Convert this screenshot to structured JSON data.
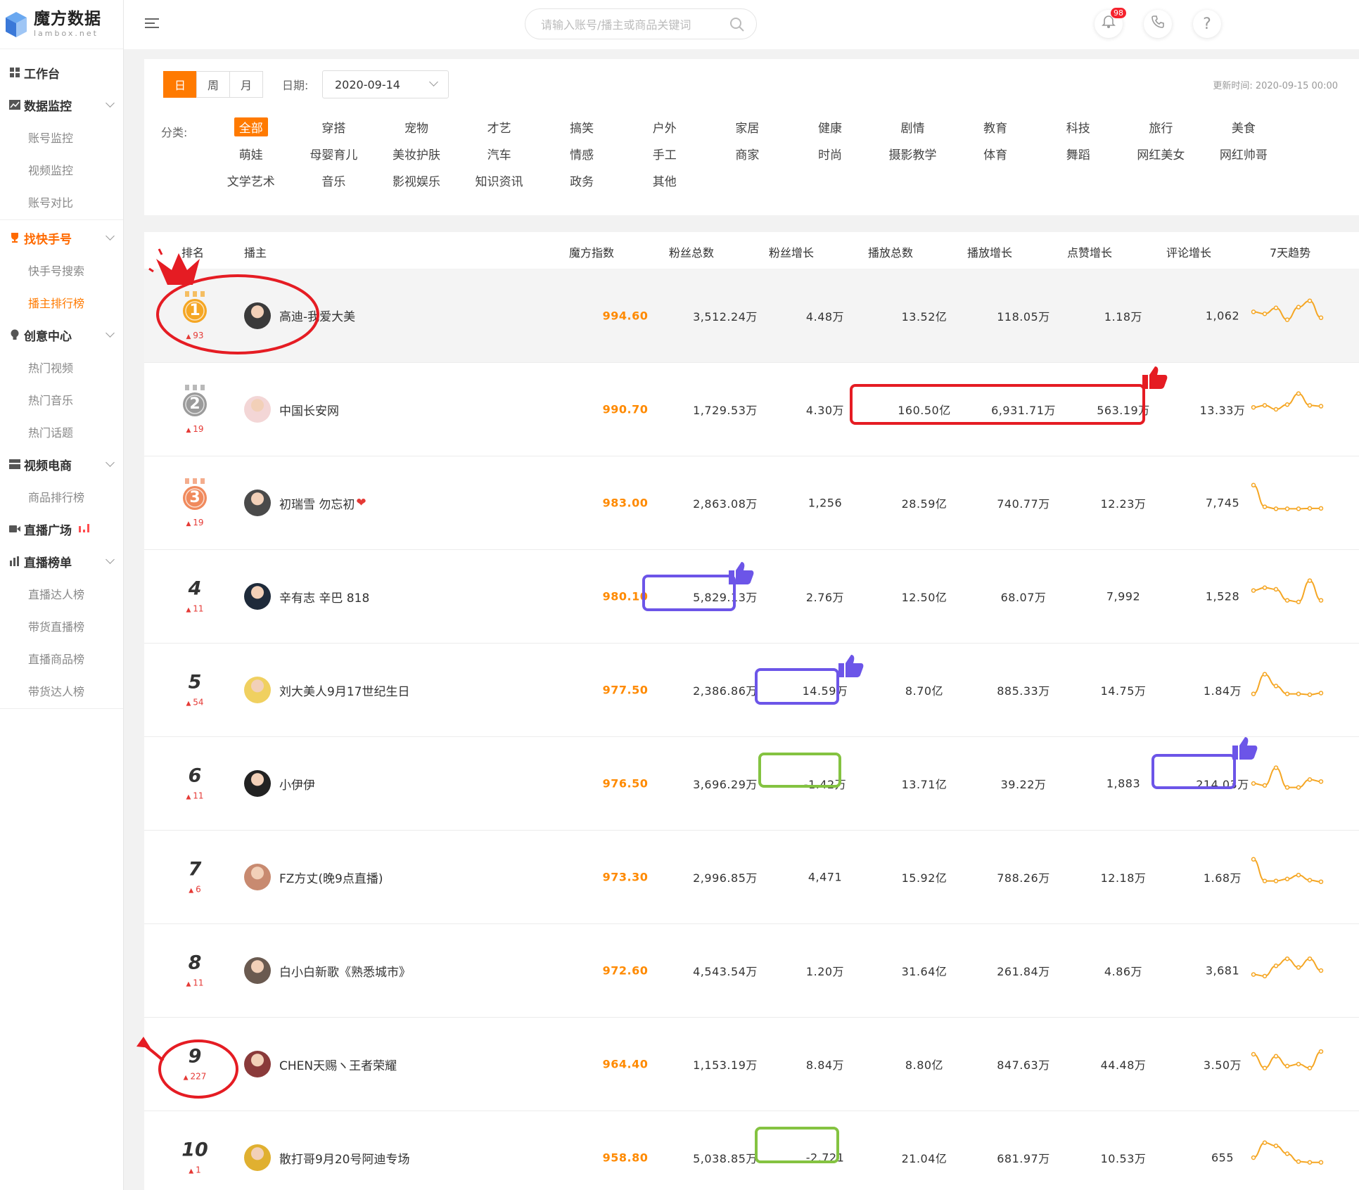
{
  "app": {
    "logo_title": "魔方数据",
    "logo_sub": "lambox.net"
  },
  "sidebar": {
    "groups": [
      {
        "label": "工作台",
        "icon": "grid-icon"
      },
      {
        "label": "数据监控",
        "icon": "chart-icon",
        "items": [
          "账号监控",
          "视频监控",
          "账号对比"
        ]
      },
      {
        "label": "找快手号",
        "icon": "trophy-icon",
        "items": [
          "快手号搜索",
          "播主排行榜"
        ]
      },
      {
        "label": "创意中心",
        "icon": "bulb-icon",
        "items": [
          "热门视频",
          "热门音乐",
          "热门话题"
        ]
      },
      {
        "label": "视频电商",
        "icon": "cart-icon",
        "items": [
          "商品排行榜"
        ]
      },
      {
        "label": "直播广场",
        "icon": "live-icon"
      },
      {
        "label": "直播榜单",
        "icon": "bar-icon",
        "items": [
          "直播达人榜",
          "带货直播榜",
          "直播商品榜",
          "带货达人榜"
        ]
      }
    ]
  },
  "topbar": {
    "search_placeholder": "请输入账号/播主或商品关键词",
    "notif_count": "98"
  },
  "filters": {
    "period": [
      "日",
      "周",
      "月"
    ],
    "date_label": "日期:",
    "date_value": "2020-09-14",
    "update_time": "更新时间: 2020-09-15 00:00",
    "category_label": "分类:",
    "categories": [
      "全部",
      "穿搭",
      "宠物",
      "才艺",
      "搞笑",
      "户外",
      "家居",
      "健康",
      "剧情",
      "教育",
      "科技",
      "旅行",
      "美食",
      "萌娃",
      "母婴育儿",
      "美妆护肤",
      "汽车",
      "情感",
      "手工",
      "商家",
      "时尚",
      "摄影教学",
      "体育",
      "舞蹈",
      "网红美女",
      "网红帅哥",
      "文学艺术",
      "音乐",
      "影视娱乐",
      "知识资讯",
      "政务",
      "其他"
    ]
  },
  "table": {
    "headers": [
      "排名",
      "播主",
      "魔方指数",
      "粉丝总数",
      "粉丝增长",
      "播放总数",
      "播放增长",
      "点赞增长",
      "评论增长",
      "7天趋势"
    ],
    "rows": [
      {
        "rank": "1",
        "up": "93",
        "name": "高迪-我爱大美",
        "score": "994.60",
        "fans": "3,512.24万",
        "fans_inc": "4.48万",
        "plays": "13.52亿",
        "plays_inc": "118.05万",
        "likes_inc": "1.18万",
        "comments_inc": "1,062",
        "trend": [
          60,
          55,
          70,
          40,
          72,
          88,
          45
        ]
      },
      {
        "rank": "2",
        "up": "19",
        "name": "中国长安网",
        "score": "990.70",
        "fans": "1,729.53万",
        "fans_inc": "4.30万",
        "plays": "160.50亿",
        "plays_inc": "6,931.71万",
        "likes_inc": "563.19万",
        "comments_inc": "13.33万",
        "trend": [
          55,
          60,
          50,
          62,
          90,
          60,
          58
        ]
      },
      {
        "rank": "3",
        "up": "19",
        "name": "初瑞雪 勿忘初",
        "score": "983.00",
        "fans": "2,863.08万",
        "fans_inc": "1,256",
        "plays": "28.59亿",
        "plays_inc": "740.77万",
        "likes_inc": "12.23万",
        "comments_inc": "7,745",
        "trend": [
          95,
          40,
          35,
          35,
          35,
          36,
          36
        ]
      },
      {
        "rank": "4",
        "up": "11",
        "name": "辛有志 辛巴 818",
        "score": "980.10",
        "fans": "5,829.13万",
        "fans_inc": "2.76万",
        "plays": "12.50亿",
        "plays_inc": "68.07万",
        "likes_inc": "7,992",
        "comments_inc": "1,528",
        "trend": [
          65,
          72,
          68,
          40,
          36,
          90,
          40
        ]
      },
      {
        "rank": "5",
        "up": "54",
        "name": "刘大美人9月17世纪生日",
        "score": "977.50",
        "fans": "2,386.86万",
        "fans_inc": "14.59万",
        "plays": "8.70亿",
        "plays_inc": "885.33万",
        "likes_inc": "14.75万",
        "comments_inc": "1.84万",
        "trend": [
          40,
          90,
          60,
          40,
          40,
          38,
          42
        ]
      },
      {
        "rank": "6",
        "up": "11",
        "name": "小伊伊",
        "score": "976.50",
        "fans": "3,696.29万",
        "fans_inc": "-1.42万",
        "plays": "13.71亿",
        "plays_inc": "39.22万",
        "likes_inc": "1,883",
        "comments_inc": "214.03万",
        "trend": [
          50,
          45,
          90,
          40,
          40,
          60,
          55
        ]
      },
      {
        "rank": "7",
        "up": "6",
        "name": "FZ方丈(晚9点直播)",
        "score": "973.30",
        "fans": "2,996.85万",
        "fans_inc": "4,471",
        "plays": "15.92亿",
        "plays_inc": "788.26万",
        "likes_inc": "12.18万",
        "comments_inc": "1.68万",
        "trend": [
          95,
          40,
          40,
          45,
          55,
          42,
          38
        ]
      },
      {
        "rank": "8",
        "up": "11",
        "name": "白小白新歌《熟悉城市》",
        "score": "972.60",
        "fans": "4,543.54万",
        "fans_inc": "1.20万",
        "plays": "31.64亿",
        "plays_inc": "261.84万",
        "likes_inc": "4.86万",
        "comments_inc": "3,681",
        "trend": [
          40,
          36,
          62,
          80,
          58,
          80,
          50
        ]
      },
      {
        "rank": "9",
        "up": "227",
        "name": "CHEN天赐ヽ王者荣耀",
        "score": "964.40",
        "fans": "1,153.19万",
        "fans_inc": "8.84万",
        "plays": "8.80亿",
        "plays_inc": "847.63万",
        "likes_inc": "44.48万",
        "comments_inc": "3.50万",
        "trend": [
          75,
          40,
          70,
          45,
          50,
          40,
          82
        ]
      },
      {
        "rank": "10",
        "up": "1",
        "name": "散打哥9月20号阿迪专场",
        "score": "958.80",
        "fans": "5,038.85万",
        "fans_inc": "-2,721",
        "plays": "21.04亿",
        "plays_inc": "681.97万",
        "likes_inc": "10.53万",
        "comments_inc": "655",
        "trend": [
          50,
          88,
          80,
          60,
          40,
          38,
          38
        ]
      }
    ]
  }
}
